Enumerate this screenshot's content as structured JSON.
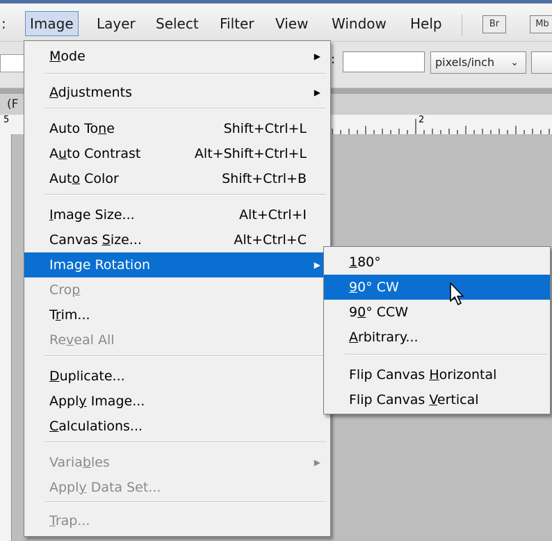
{
  "menubar": {
    "items": [
      "Image",
      "Layer",
      "Select",
      "Filter",
      "View",
      "Window",
      "Help"
    ],
    "badges": [
      "Br",
      "Mb"
    ]
  },
  "options": {
    "resolution_units": "pixels/inch"
  },
  "tab": {
    "stub": "(F"
  },
  "ruler": {
    "left_mark": "5",
    "mark_2": "2"
  },
  "image_menu": {
    "items": [
      {
        "label": "Mode",
        "shortcut": "",
        "submenu": true,
        "disabled": false
      },
      {
        "label": "Adjustments",
        "shortcut": "",
        "submenu": true,
        "disabled": false
      },
      {
        "label": "Auto Tone",
        "shortcut": "Shift+Ctrl+L",
        "submenu": false,
        "disabled": false
      },
      {
        "label": "Auto Contrast",
        "shortcut": "Alt+Shift+Ctrl+L",
        "submenu": false,
        "disabled": false
      },
      {
        "label": "Auto Color",
        "shortcut": "Shift+Ctrl+B",
        "submenu": false,
        "disabled": false
      },
      {
        "label": "Image Size...",
        "shortcut": "Alt+Ctrl+I",
        "submenu": false,
        "disabled": false
      },
      {
        "label": "Canvas Size...",
        "shortcut": "Alt+Ctrl+C",
        "submenu": false,
        "disabled": false
      },
      {
        "label": "Image Rotation",
        "shortcut": "",
        "submenu": true,
        "disabled": false,
        "highlighted": true
      },
      {
        "label": "Crop",
        "shortcut": "",
        "submenu": false,
        "disabled": true
      },
      {
        "label": "Trim...",
        "shortcut": "",
        "submenu": false,
        "disabled": false
      },
      {
        "label": "Reveal All",
        "shortcut": "",
        "submenu": false,
        "disabled": true
      },
      {
        "label": "Duplicate...",
        "shortcut": "",
        "submenu": false,
        "disabled": false
      },
      {
        "label": "Apply Image...",
        "shortcut": "",
        "submenu": false,
        "disabled": false
      },
      {
        "label": "Calculations...",
        "shortcut": "",
        "submenu": false,
        "disabled": false
      },
      {
        "label": "Variables",
        "shortcut": "",
        "submenu": true,
        "disabled": true
      },
      {
        "label": "Apply Data Set...",
        "shortcut": "",
        "submenu": false,
        "disabled": true
      },
      {
        "label": "Trap...",
        "shortcut": "",
        "submenu": false,
        "disabled": true
      }
    ]
  },
  "rotation_submenu": {
    "items": [
      {
        "label": "180°"
      },
      {
        "label": "90° CW",
        "highlighted": true
      },
      {
        "label": "90° CCW"
      },
      {
        "label": "Arbitrary..."
      },
      {
        "label": "Flip Canvas Horizontal"
      },
      {
        "label": "Flip Canvas Vertical"
      }
    ]
  },
  "colors": {
    "highlight": "#0a6fd1",
    "disabled_text": "#8a8a8a",
    "menu_bg": "#f0f0f0"
  },
  "icons": {
    "submenu_arrow": "triangle-right-icon",
    "pointer": "mouse-pointer-icon"
  }
}
